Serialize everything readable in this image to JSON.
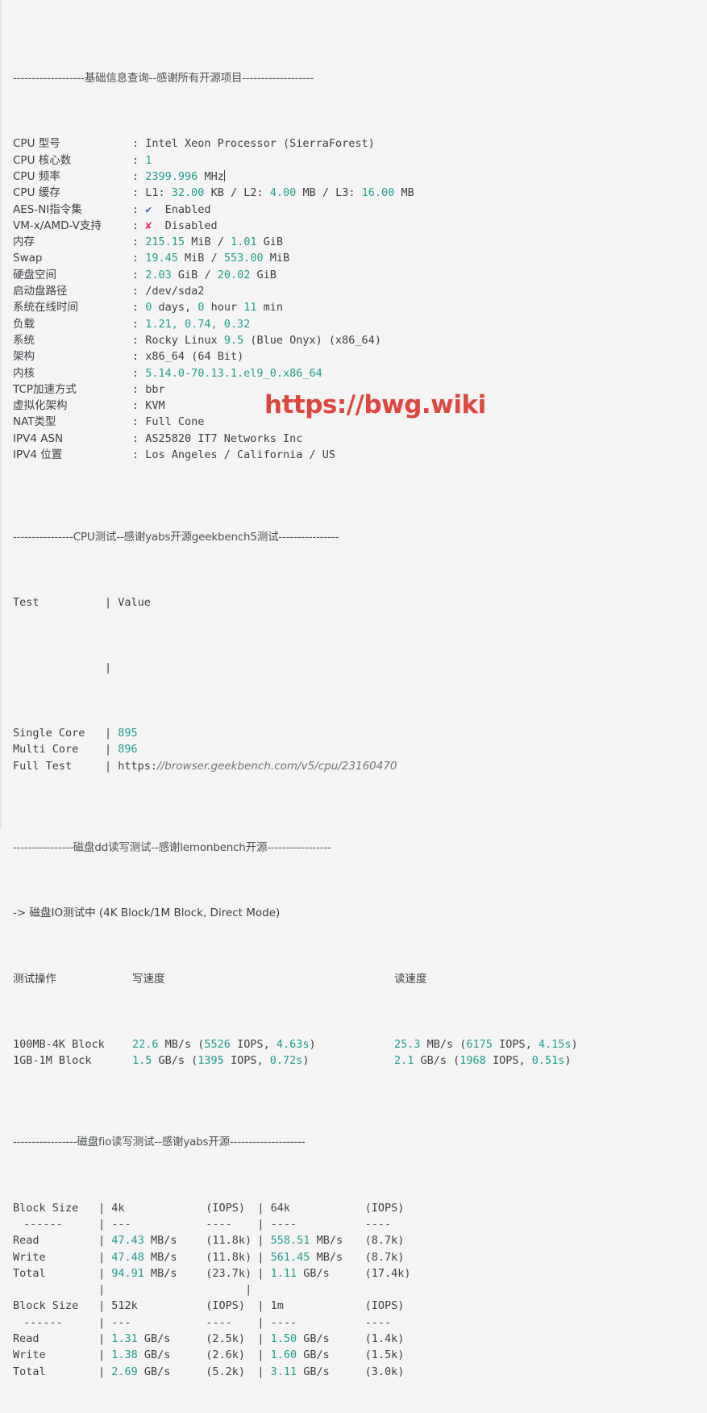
{
  "terminal": {
    "watermark": "https://bwg.wiki",
    "sections": {
      "basic_header": "-------------------基础信息查询--感谢所有开源项目-------------------",
      "cpu_header": "----------------CPU测试--感谢yabs开源geekbench5测试----------------",
      "dd_header": "----------------磁盘dd读写测试--感谢lemonbench开源-----------------",
      "fio_header": "-----------------磁盘fio读写测试--感谢yabs开源--------------------"
    },
    "basic_info": [
      {
        "label": "CPU 型号",
        "colon": ":",
        "value": "Intel Xeon Processor (SierraForest)",
        "style": "plain"
      },
      {
        "label": "CPU 核心数",
        "colon": ":",
        "value": "1",
        "style": "teal"
      },
      {
        "label": "CPU 频率",
        "colon": ":",
        "value": "2399.996 MHz",
        "style": "teal-num",
        "cursor": true
      },
      {
        "label": "CPU 缓存",
        "colon": ":",
        "value": "L1: 32.00 KB / L2: 4.00 MB / L3: 16.00 MB",
        "style": "cache"
      },
      {
        "label": "AES-NI指令集",
        "colon": ":",
        "value": "Enabled",
        "style": "plain",
        "icon": "check-icon"
      },
      {
        "label": "VM-x/AMD-V支持",
        "colon": ":",
        "value": "Disabled",
        "style": "plain",
        "icon": "cross-icon"
      },
      {
        "label": "内存",
        "colon": ":",
        "value": "215.15 MiB / 1.01 GiB",
        "style": "mem"
      },
      {
        "label": "Swap",
        "colon": ":",
        "value": "19.45 MiB / 553.00 MiB",
        "style": "mem"
      },
      {
        "label": "硬盘空间",
        "colon": ":",
        "value": "2.03 GiB / 20.02 GiB",
        "style": "mem"
      },
      {
        "label": "启动盘路径",
        "colon": ":",
        "value": "/dev/sda2",
        "style": "plain"
      },
      {
        "label": "系统在线时间",
        "colon": ":",
        "value": "0 days, 0 hour 11 min",
        "style": "uptime"
      },
      {
        "label": "负载",
        "colon": ":",
        "value": "1.21, 0.74, 0.32",
        "style": "teal"
      },
      {
        "label": "系统",
        "colon": ":",
        "value": "Rocky Linux 9.5 (Blue Onyx) (x86_64)",
        "style": "os"
      },
      {
        "label": "架构",
        "colon": ":",
        "value": "x86_64 (64 Bit)",
        "style": "arch"
      },
      {
        "label": "内核",
        "colon": ":",
        "value": "5.14.0-70.13.1.el9_0.x86_64",
        "style": "teal"
      },
      {
        "label": "TCP加速方式",
        "colon": ":",
        "value": "bbr",
        "style": "plain"
      },
      {
        "label": "虚拟化架构",
        "colon": ":",
        "value": "KVM",
        "style": "plain"
      },
      {
        "label": "NAT类型",
        "colon": ":",
        "value": "Full Cone",
        "style": "plain"
      },
      {
        "label": "IPV4 ASN",
        "colon": ":",
        "value": "AS25820 IT7 Networks Inc",
        "style": "plain"
      },
      {
        "label": "IPV4 位置",
        "colon": ":",
        "value": "Los Angeles / California / US",
        "style": "plain"
      }
    ],
    "cpu_test": {
      "col_test": "Test",
      "col_value": "Value",
      "pipe": "|",
      "rows": [
        {
          "name": "Single Core",
          "value": "895",
          "style": "teal"
        },
        {
          "name": "Multi Core",
          "value": "896",
          "style": "teal"
        },
        {
          "name": "Full Test",
          "value_proto": "https:",
          "value_link": "//browser.geekbench.com/v5/cpu/23160470",
          "style": "link"
        }
      ]
    },
    "dd_test": {
      "progress_line": "-> 磁盘IO测试中 (4K Block/1M Block, Direct Mode)",
      "col_op": "测试操作",
      "col_write": "写速度",
      "col_read": "读速度",
      "rows": [
        {
          "op": "100MB-4K Block",
          "write_num": "22.6",
          "write_unit": "MB/s",
          "write_iops": "5526",
          "write_iops_label": "IOPS",
          "write_time": "4.63s",
          "read_num": "25.3",
          "read_unit": "MB/s",
          "read_iops": "6175",
          "read_iops_label": "IOPS",
          "read_time": "4.15s"
        },
        {
          "op": "1GB-1M Block",
          "write_num": "1.5",
          "write_unit": "GB/s",
          "write_iops": "1395",
          "write_iops_label": "IOPS",
          "write_time": "0.72s",
          "read_num": "2.1",
          "read_unit": "GB/s",
          "read_iops": "1968",
          "read_iops_label": "IOPS",
          "read_time": "0.51s"
        }
      ]
    },
    "fio_test": {
      "blocks": [
        {
          "header_label": "Block Size",
          "size_a": "4k",
          "iops_a": "(IOPS)",
          "size_b": "64k",
          "iops_b": "(IOPS)",
          "sep_a": "------",
          "sep_b": "---",
          "sep_c": "----",
          "sep_d": "----",
          "sep_e": "----",
          "rows": [
            {
              "name": "Read",
              "a_num": "47.43",
              "a_unit": "MB/s",
              "a_iops": "(11.8k)",
              "b_num": "558.51",
              "b_unit": "MB/s",
              "b_iops": "(8.7k)"
            },
            {
              "name": "Write",
              "a_num": "47.48",
              "a_unit": "MB/s",
              "a_iops": "(11.8k)",
              "b_num": "561.45",
              "b_unit": "MB/s",
              "b_iops": "(8.7k)"
            },
            {
              "name": "Total",
              "a_num": "94.91",
              "a_unit": "MB/s",
              "a_iops": "(23.7k)",
              "b_num": "1.11",
              "b_unit": "GB/s",
              "b_iops": "(17.4k)"
            }
          ]
        },
        {
          "header_label": "Block Size",
          "size_a": "512k",
          "iops_a": "(IOPS)",
          "size_b": "1m",
          "iops_b": "(IOPS)",
          "sep_a": "------",
          "sep_b": "---",
          "sep_c": "----",
          "sep_d": "----",
          "sep_e": "----",
          "rows": [
            {
              "name": "Read",
              "a_num": "1.31",
              "a_unit": "GB/s",
              "a_iops": "(2.5k)",
              "b_num": "1.50",
              "b_unit": "GB/s",
              "b_iops": "(1.4k)"
            },
            {
              "name": "Write",
              "a_num": "1.38",
              "a_unit": "GB/s",
              "a_iops": "(2.6k)",
              "b_num": "1.60",
              "b_unit": "GB/s",
              "b_iops": "(1.5k)"
            },
            {
              "name": "Total",
              "a_num": "2.69",
              "a_unit": "GB/s",
              "a_iops": "(5.2k)",
              "b_num": "3.11",
              "b_unit": "GB/s",
              "b_iops": "(3.0k)"
            }
          ]
        }
      ]
    },
    "colors": {
      "value_teal": "#1f9e8c",
      "text": "#3a3f44",
      "background": "#f4f4f4",
      "check": "#4c5fd7",
      "cross": "#e8336d",
      "watermark": "#d93025"
    }
  }
}
